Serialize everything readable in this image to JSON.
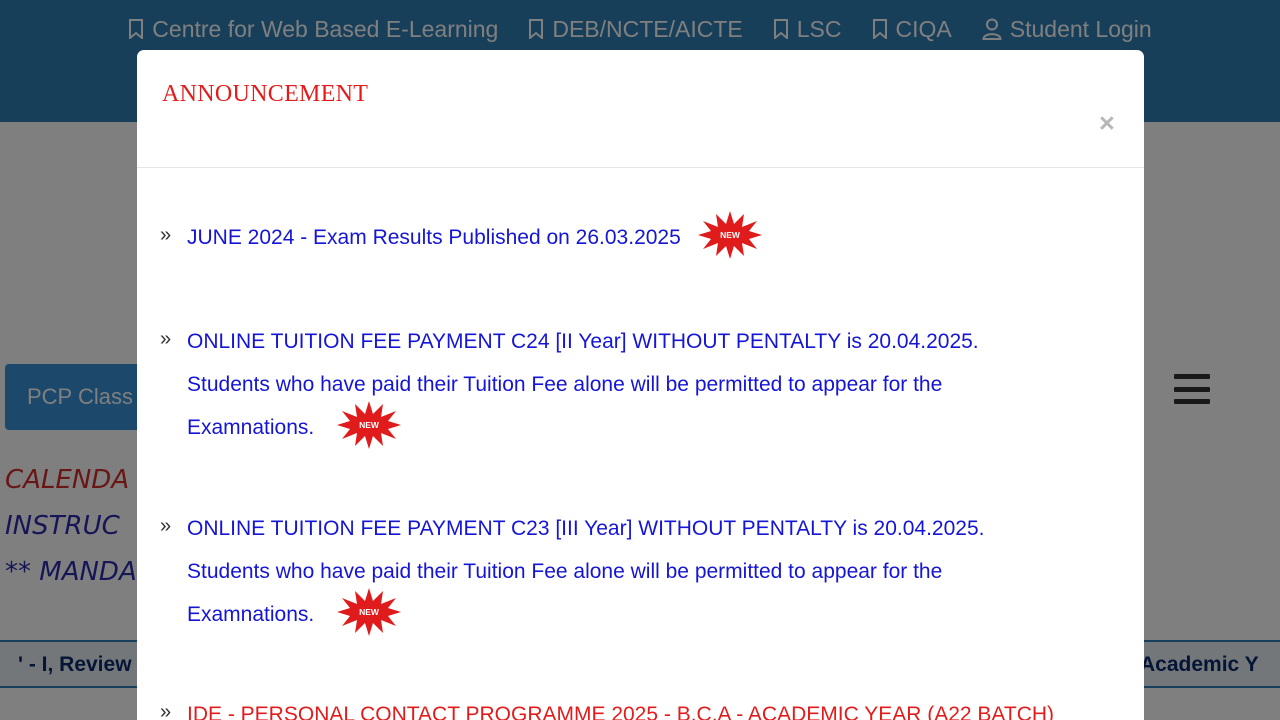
{
  "top_nav": {
    "items": [
      {
        "label": "Centre for Web Based E-Learning",
        "icon": "bookmark-icon"
      },
      {
        "label": "DEB/NCTE/AICTE",
        "icon": "bookmark-icon"
      },
      {
        "label": "LSC",
        "icon": "bookmark-icon"
      },
      {
        "label": "CIQA",
        "icon": "bookmark-icon"
      },
      {
        "label": "Student Login",
        "icon": "user-icon"
      }
    ]
  },
  "background": {
    "pcp_button_label": "PCP Class",
    "line1": "CALENDA",
    "line2": "INSTRUC",
    "line3": "** MANDA",
    "marquee_left": "' - I, Review",
    "marquee_right": "Academic Y"
  },
  "modal": {
    "title": "ANNOUNCEMENT",
    "close_label": "×",
    "bullet": "»",
    "badge_text": "NEW",
    "announcements": [
      {
        "line1": "JUNE 2024 - Exam Results Published on 26.03.2025",
        "has_badge": true
      },
      {
        "line1": "ONLINE TUITION FEE PAYMENT C24 [II Year] WITHOUT PENTALTY is 20.04.2025.",
        "line2": "Students who have paid their Tuition Fee alone will be permitted to appear for the",
        "line3": "Examnations.",
        "has_badge": true
      },
      {
        "line1": "ONLINE TUITION FEE PAYMENT C23 [III Year] WITHOUT PENTALTY is 20.04.2025.",
        "line2": "Students who have paid their Tuition Fee alone will be permitted to appear for the",
        "line3": "Examnations.",
        "has_badge": true
      },
      {
        "line1": "IDE - PERSONAL CONTACT PROGRAMME 2025 - B.C.A - ACADEMIC YEAR (A22 BATCH)",
        "has_badge": false
      }
    ]
  },
  "colors": {
    "header_blue": "#2e7fb5",
    "link_blue": "#1515d6",
    "title_red": "#e41b1b",
    "badge_red": "#e01b1b"
  }
}
